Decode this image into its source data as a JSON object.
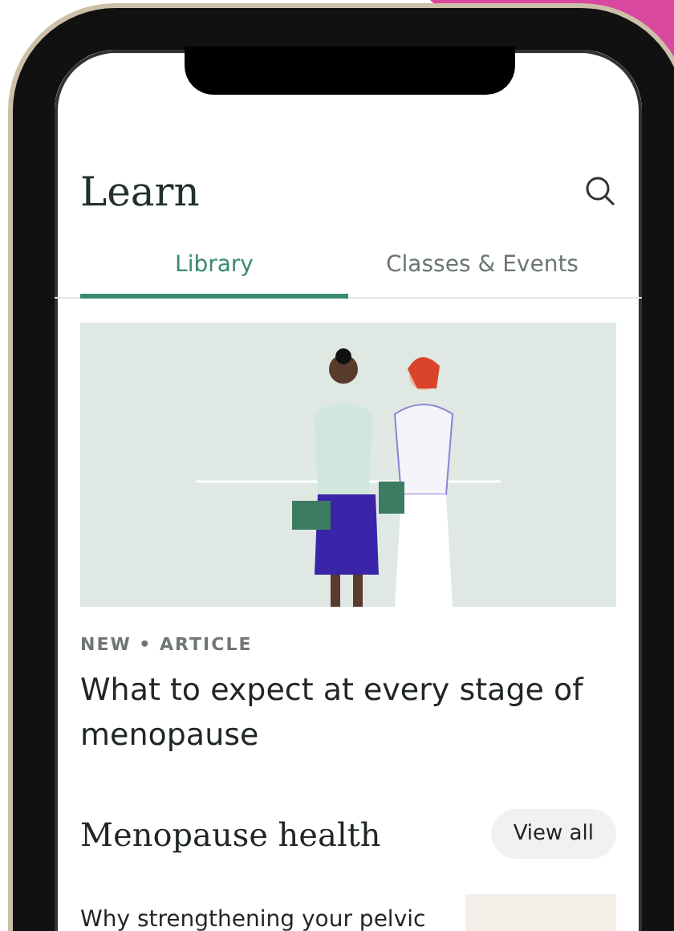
{
  "header": {
    "title": "Learn"
  },
  "tabs": [
    {
      "label": "Library",
      "selected": true
    },
    {
      "label": "Classes & Events",
      "selected": false
    }
  ],
  "featured": {
    "tag": "NEW • ARTICLE",
    "title": "What to expect at every stage of menopause"
  },
  "section": {
    "title": "Menopause health",
    "button": "View all"
  },
  "articles": [
    {
      "title": "Why strengthening your pelvic"
    }
  ]
}
